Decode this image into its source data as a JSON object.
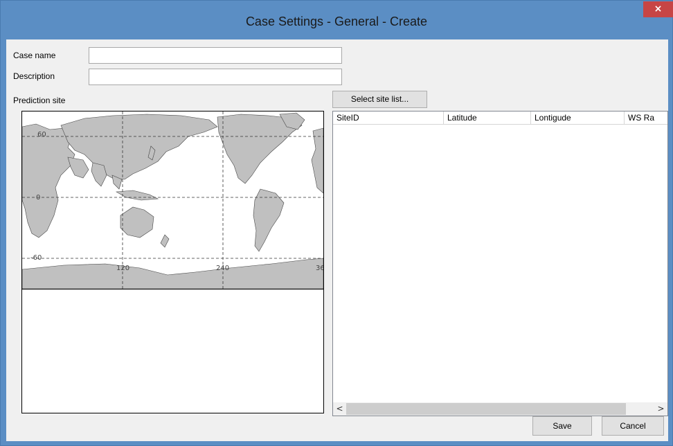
{
  "window": {
    "title": "Case Settings - General - Create",
    "close_glyph": "×"
  },
  "form": {
    "case_name_label": "Case name",
    "case_name_value": "",
    "description_label": "Description",
    "description_value": "",
    "prediction_site_label": "Prediction site",
    "select_site_button": "Select site list..."
  },
  "map": {
    "lat_labels": [
      "60",
      "0",
      "-60"
    ],
    "lon_labels": [
      "120",
      "240",
      "36"
    ]
  },
  "grid": {
    "columns": [
      "SiteID",
      "Latitude",
      "Lontigude",
      "WS Ra"
    ],
    "rows": []
  },
  "scroll": {
    "left_glyph": "<",
    "right_glyph": ">"
  },
  "footer": {
    "save_label": "Save",
    "cancel_label": "Cancel"
  },
  "colors": {
    "title_bar": "#5b8ec4",
    "close_button": "#c74545",
    "land": "#c0c0c0"
  }
}
